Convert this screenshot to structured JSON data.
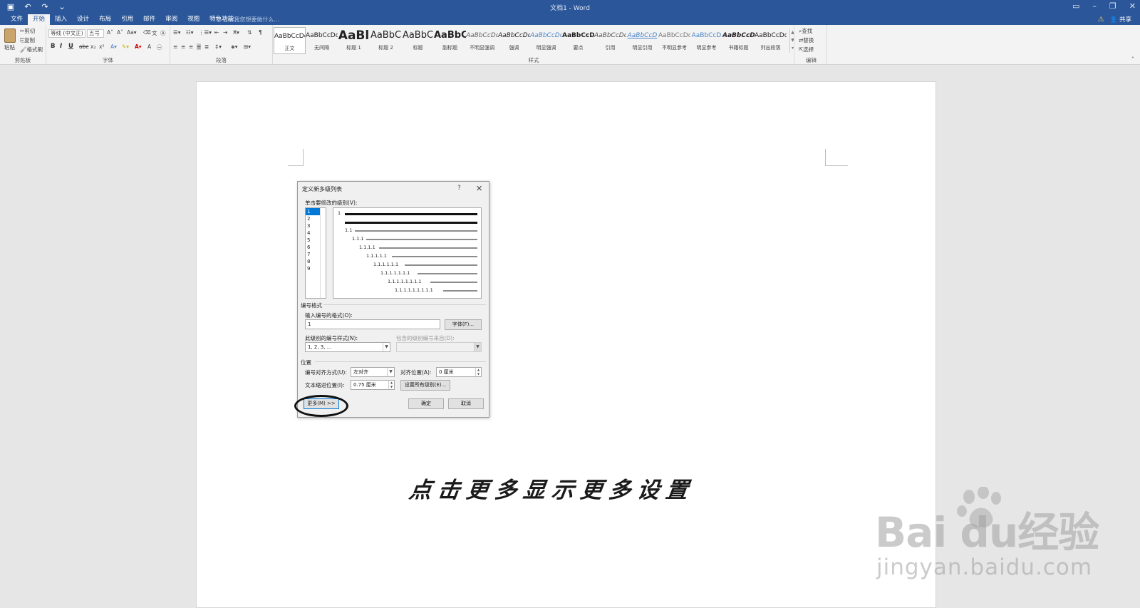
{
  "titlebar": {
    "doc_title": "文档1 - Word"
  },
  "tabs": [
    "文件",
    "开始",
    "插入",
    "设计",
    "布局",
    "引用",
    "邮件",
    "审阅",
    "视图",
    "特色功能"
  ],
  "tell_me": "告诉我您想要做什么...",
  "share": "共享",
  "ribbon": {
    "clipboard": {
      "paste": "粘贴",
      "cut": "剪切",
      "copy": "复制",
      "format_painter": "格式刷",
      "label": "剪贴板"
    },
    "font": {
      "name": "等线 (中文正)",
      "size": "五号",
      "label": "字体"
    },
    "paragraph": {
      "label": "段落"
    },
    "styles": {
      "label": "样式",
      "items": [
        {
          "sample": "AaBbCcDc",
          "name": "正文"
        },
        {
          "sample": "AaBbCcDc",
          "name": "无间隔"
        },
        {
          "sample": "AaBl",
          "name": "标题 1"
        },
        {
          "sample": "AaBbC",
          "name": "标题 2"
        },
        {
          "sample": "AaBbC",
          "name": "标题"
        },
        {
          "sample": "AaBbC",
          "name": "副标题"
        },
        {
          "sample": "AaBbCcDc",
          "name": "不明显强调"
        },
        {
          "sample": "AaBbCcDc",
          "name": "强调"
        },
        {
          "sample": "AaBbCcDc",
          "name": "明显强调"
        },
        {
          "sample": "AaBbCcD",
          "name": "要点"
        },
        {
          "sample": "AaBbCcDc",
          "name": "引用"
        },
        {
          "sample": "AaBbCcD",
          "name": "明显引用"
        },
        {
          "sample": "AaBbCcDc",
          "name": "不明显参考"
        },
        {
          "sample": "AaBbCcD",
          "name": "明显参考"
        },
        {
          "sample": "AaBbCcD",
          "name": "书籍标题"
        },
        {
          "sample": "AaBbCcDc",
          "name": "列出段落"
        }
      ]
    },
    "editing": {
      "find": "查找",
      "replace": "替换",
      "select": "选择",
      "label": "编辑"
    }
  },
  "dialog": {
    "title": "定义新多级列表",
    "help": "?",
    "close": "✕",
    "level_prompt": "单击要修改的级别(V):",
    "levels": [
      "1",
      "2",
      "3",
      "4",
      "5",
      "6",
      "7",
      "8",
      "9"
    ],
    "preview_numbers": [
      "1",
      "1.1",
      "1.1.1",
      "1.1.1.1",
      "1.1.1.1.1",
      "1.1.1.1.1.1",
      "1.1.1.1.1.1.1",
      "1.1.1.1.1.1.1.1",
      "1.1.1.1.1.1.1.1.1"
    ],
    "number_format_section": "编号格式",
    "enter_format_label": "输入编号的格式(O):",
    "enter_format_value": "1",
    "font_button": "字体(F)...",
    "number_style_label": "此级别的编号样式(N):",
    "number_style_value": "1, 2, 3, ...",
    "include_level_label": "包含的级别编号来自(D):",
    "position_section": "位置",
    "alignment_label": "编号对齐方式(U):",
    "alignment_value": "左对齐",
    "align_at_label": "对齐位置(A):",
    "align_at_value": "0 厘米",
    "indent_label": "文本缩进位置(I):",
    "indent_value": "0.75 厘米",
    "set_all_button": "设置所有级别(E)...",
    "more_button": "更多(M) >>",
    "ok_button": "确定",
    "cancel_button": "取消"
  },
  "caption": "点击更多显示更多设置",
  "watermark": {
    "logo": "Bai  du经验",
    "url": "jingyan.baidu.com"
  },
  "colors": {
    "accent": "#2b579a",
    "selection": "#0078d7"
  }
}
